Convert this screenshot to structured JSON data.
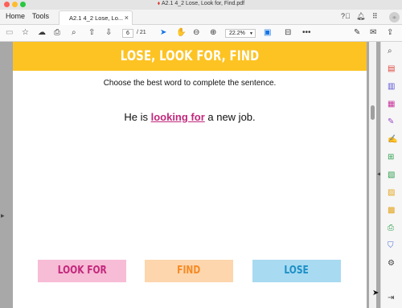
{
  "window": {
    "title": "A2.1 4_2 Lose, Look for, Find.pdf"
  },
  "nav": {
    "home": "Home",
    "tools": "Tools",
    "tab_label": "A2.1 4_2 Lose, Lo...",
    "tab_close": "×"
  },
  "toolbar": {
    "page_current": "6",
    "page_total": "/ 21",
    "zoom": "22.2%"
  },
  "document": {
    "banner_title": "LOSE, LOOK FOR, FIND",
    "instruction": "Choose the best word to complete the sentence.",
    "sentence_before": "He is ",
    "sentence_answer": "looking for",
    "sentence_after": " a new job.",
    "choices": [
      "LOOK FOR",
      "FIND",
      "LOSE"
    ]
  },
  "icons": {
    "help": "help-icon",
    "bell": "bell-icon",
    "grid": "apps-grid-icon"
  },
  "colors": {
    "banner": "#fdc323",
    "answer": "#c2287c",
    "choice_pink": "#f7bcd6",
    "choice_orange": "#fdd6ae",
    "choice_blue": "#a8daf1",
    "accent": "#1473e6"
  }
}
